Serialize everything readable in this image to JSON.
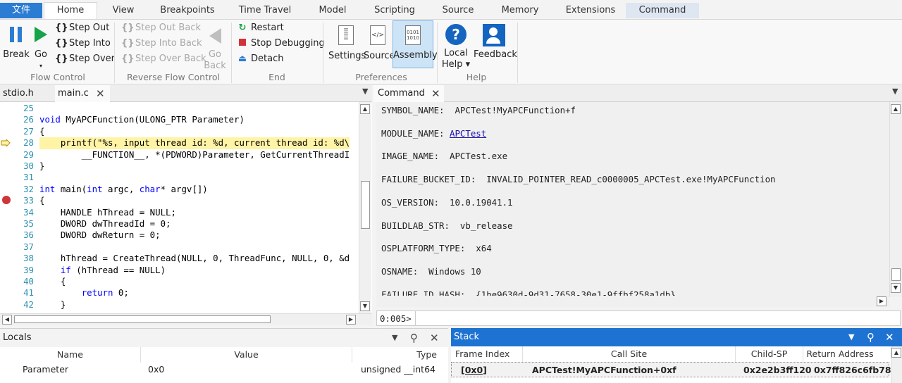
{
  "ribbon_tabs": [
    "文件",
    "Home",
    "View",
    "Breakpoints",
    "Time Travel",
    "Model",
    "Scripting",
    "Source",
    "Memory",
    "Extensions",
    "Command"
  ],
  "flow_control": {
    "break": "Break",
    "go": "Go",
    "step_out": "Step Out",
    "step_into": "Step Into",
    "step_over": "Step Over",
    "group": "Flow Control"
  },
  "reverse_flow": {
    "step_out_back": "Step Out Back",
    "step_into_back": "Step Into Back",
    "step_over_back": "Step Over Back",
    "go_back_1": "Go",
    "go_back_2": "Back",
    "group": "Reverse Flow Control"
  },
  "end": {
    "restart": "Restart",
    "stop": "Stop Debugging",
    "detach": "Detach",
    "group": "End"
  },
  "preferences": {
    "settings": "Settings",
    "source": "Source",
    "assembly": "Assembly",
    "group": "Preferences"
  },
  "help": {
    "local_1": "Local",
    "local_2": "Help",
    "feedback": "Feedback",
    "group": "Help"
  },
  "source_tabs": [
    "stdio.h",
    "main.c"
  ],
  "code_lines": [
    {
      "n": "25",
      "t": ""
    },
    {
      "n": "26",
      "t": "void MyAPCFunction(ULONG_PTR Parameter)"
    },
    {
      "n": "27",
      "t": "{"
    },
    {
      "n": "28",
      "t": "    printf(\"%s, input thread id: %d, current thread id: %d\\"
    },
    {
      "n": "29",
      "t": "        __FUNCTION__, *(PDWORD)Parameter, GetCurrentThreadI"
    },
    {
      "n": "30",
      "t": "}"
    },
    {
      "n": "31",
      "t": ""
    },
    {
      "n": "32",
      "t": "int main(int argc, char* argv[])"
    },
    {
      "n": "33",
      "t": "{"
    },
    {
      "n": "34",
      "t": "    HANDLE hThread = NULL;"
    },
    {
      "n": "35",
      "t": "    DWORD dwThreadId = 0;"
    },
    {
      "n": "36",
      "t": "    DWORD dwReturn = 0;"
    },
    {
      "n": "37",
      "t": ""
    },
    {
      "n": "38",
      "t": "    hThread = CreateThread(NULL, 0, ThreadFunc, NULL, 0, &d"
    },
    {
      "n": "39",
      "t": "    if (hThread == NULL)"
    },
    {
      "n": "40",
      "t": "    {"
    },
    {
      "n": "41",
      "t": "        return 0;"
    },
    {
      "n": "42",
      "t": "    }"
    }
  ],
  "command_tab": "Command",
  "command_output": [
    {
      "k": "SYMBOL_NAME:  ",
      "v": "APCTest!MyAPCFunction+f"
    },
    {
      "k": "MODULE_NAME: ",
      "v": "APCTest",
      "link": true
    },
    {
      "k": "IMAGE_NAME:  ",
      "v": "APCTest.exe"
    },
    {
      "k": "FAILURE_BUCKET_ID:  ",
      "v": "INVALID_POINTER_READ_c0000005_APCTest.exe!MyAPCFunction"
    },
    {
      "k": "OS_VERSION:  ",
      "v": "10.0.19041.1"
    },
    {
      "k": "BUILDLAB_STR:  ",
      "v": "vb_release"
    },
    {
      "k": "OSPLATFORM_TYPE:  ",
      "v": "x64"
    },
    {
      "k": "OSNAME:  ",
      "v": "Windows 10"
    },
    {
      "k": "FAILURE_ID_HASH:  ",
      "v": "{1be9630d-9d31-7658-30e1-9ffbf258a1db}"
    }
  ],
  "command_prompt": "0:005>",
  "locals": {
    "title": "Locals",
    "columns": [
      "Name",
      "Value",
      "Type"
    ],
    "rows": [
      {
        "name": "Parameter",
        "value": "0x0",
        "type": "unsigned __int64"
      }
    ]
  },
  "stack": {
    "title": "Stack",
    "columns": [
      "Frame Index",
      "Call Site",
      "Child-SP",
      "Return Address"
    ],
    "rows": [
      {
        "index": "[0x0]",
        "site": "APCTest!MyAPCFunction+0xf",
        "sp": "0x2e2b3ff120",
        "ret": "0x7ff826c6fb78"
      }
    ]
  },
  "colors": {
    "accent": "#2b7cd3",
    "stack_header": "#1e73d2",
    "breakpoint": "#d13438",
    "current_line": "#fff3a6"
  }
}
